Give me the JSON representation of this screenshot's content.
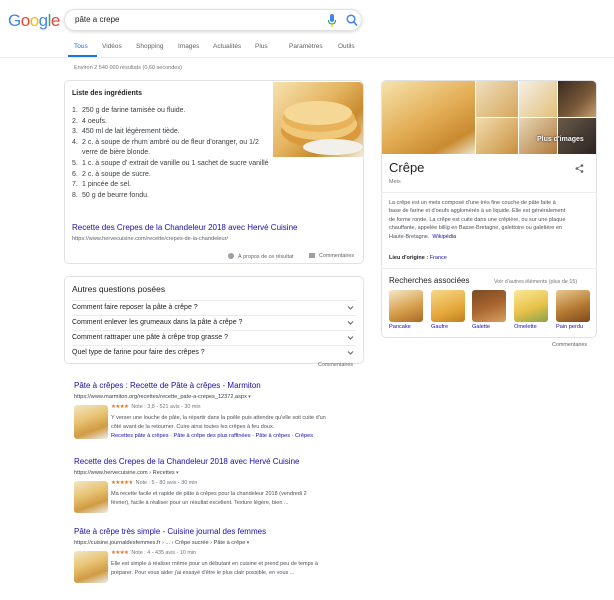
{
  "logo": {
    "text": "Google",
    "letters": [
      "G",
      "o",
      "o",
      "g",
      "l",
      "e"
    ],
    "colors": [
      "#4285f4",
      "#ea4335",
      "#fbbc05",
      "#4285f4",
      "#34a853",
      "#ea4335"
    ]
  },
  "search": {
    "query": "pâte a crepe"
  },
  "tabs": [
    {
      "label": "Tous",
      "active": true
    },
    {
      "label": "Vidéos",
      "active": false
    },
    {
      "label": "Shopping",
      "active": false
    },
    {
      "label": "Images",
      "active": false
    },
    {
      "label": "Actualités",
      "active": false
    },
    {
      "label": "Plus",
      "active": false
    },
    {
      "label": "Paramètres",
      "active": false
    },
    {
      "label": "Outils",
      "active": false
    }
  ],
  "stats": "Environ 2 540 000 résultats (0,60 secondes)",
  "featured": {
    "title": "Liste des ingrédients",
    "items": [
      {
        "n": "1.",
        "text": "250 g de farine tamisée ou fluide."
      },
      {
        "n": "2.",
        "text": "4 oeufs."
      },
      {
        "n": "3.",
        "text": "450 ml de lait légèrement tiède."
      },
      {
        "n": "4.",
        "text": "2 c. à soupe de rhum ambré ou de fleur d'oranger, ou 1/2 verre de bière blonde."
      },
      {
        "n": "5.",
        "text": "1 c. à soupe d' extrait de vanille ou 1 sachet de sucre vanillé"
      },
      {
        "n": "6.",
        "text": "2 c. à soupe de sucre."
      },
      {
        "n": "7.",
        "text": "1 pincée de sel."
      },
      {
        "n": "8.",
        "text": "50 g de beurre fondu."
      }
    ],
    "link": "Recette des Crepes de la Chandeleur 2018 avec Hervé Cuisine",
    "url": "https://www.hervecuisine.com/recette/crepes-de-la-chandeleur/",
    "about": "À propos de ce résultat",
    "comments": "Commentaires"
  },
  "paa": {
    "title": "Autres questions posées",
    "questions": [
      "Comment faire reposer la pâte à crêpe ?",
      "Comment enlever les grumeaux dans la pâte à crêpe ?",
      "Comment rattraper une pâte à crêpe trop grasse ?",
      "Quel type de farine pour faire des crêpes ?"
    ],
    "comments": "Commentaires"
  },
  "results": [
    {
      "title": "Pâte à crêpes : Recette de Pâte à crêpes - Marmiton",
      "url": "https://www.marmiton.org/recettes/recette_pate-a-crepes_12372.aspx",
      "stars": "★★★★",
      "rating": "Note : 3,8 - 521 avis - 30 min",
      "snippet_lines": [
        "Y verser une louche de pâte, la répartir dans la poêle puis attendre qu'elle soit cuite d'un",
        "côté avant de la retourner. Cuire ainsi toutes les crêpes à feu doux."
      ],
      "sitelinks": "Recettes pâte à crêpes · Pâte à crêpe des plus raffinées · Pâte à crêpes · Crêpes"
    },
    {
      "title": "Recette des Crepes de la Chandeleur 2018 avec Hervé Cuisine",
      "url": "https://www.hervecuisine.com › Recettes",
      "stars": "★★★★★",
      "rating": "Note : 5 - 80 avis - 30 min",
      "snippet_lines": [
        "Ma recette facile et rapide de pâte à crêpes pour la chandeleur 2018 (vendredi 2",
        "février), facile à réaliser pour un résultat excellent. Texture légère, bien ..."
      ],
      "sitelinks": ""
    },
    {
      "title": "Pâte à crêpe très simple - Cuisine journal des femmes",
      "url": "https://cuisine.journaldesfemmes.fr › ... › Crêpe sucrée › Pâte à crêpe",
      "stars": "★★★★",
      "rating": "Note : 4 - 435 avis - 10 min",
      "snippet_lines": [
        "Elle est simple à réaliser même pour un débutant en cuisine et prend peu de temps à",
        "préparer. Pour vous aider j'ai essayé d'être le plus clair possible, en vous ..."
      ],
      "sitelinks": ""
    }
  ],
  "knowledge": {
    "more_images": "Plus d'images",
    "title": "Crêpe",
    "subtitle": "Mets",
    "desc_lines": [
      "La crêpe est un mets composé d'une très fine couche de pâte faite à",
      "base de farine et d'oeufs agglomérés à un liquide. Elle est généralement",
      "de forme ronde. La crêpe est cuite dans une crêpière, ou sur une plaque",
      "chauffante, appelée billig en Basse-Bretagne, galettoire ou galetière en",
      "Haute-Bretagne."
    ],
    "wiki": "Wikipédia",
    "origin_label": "Lieu d'origine :",
    "origin_value": "France",
    "related_title": "Recherches associées",
    "related_more": "Voir d'autres éléments (plus de 15)",
    "related": [
      "Pancake",
      "Gaufre",
      "Galette",
      "Omelette",
      "Pain perdu"
    ],
    "comments": "Commentaires"
  }
}
